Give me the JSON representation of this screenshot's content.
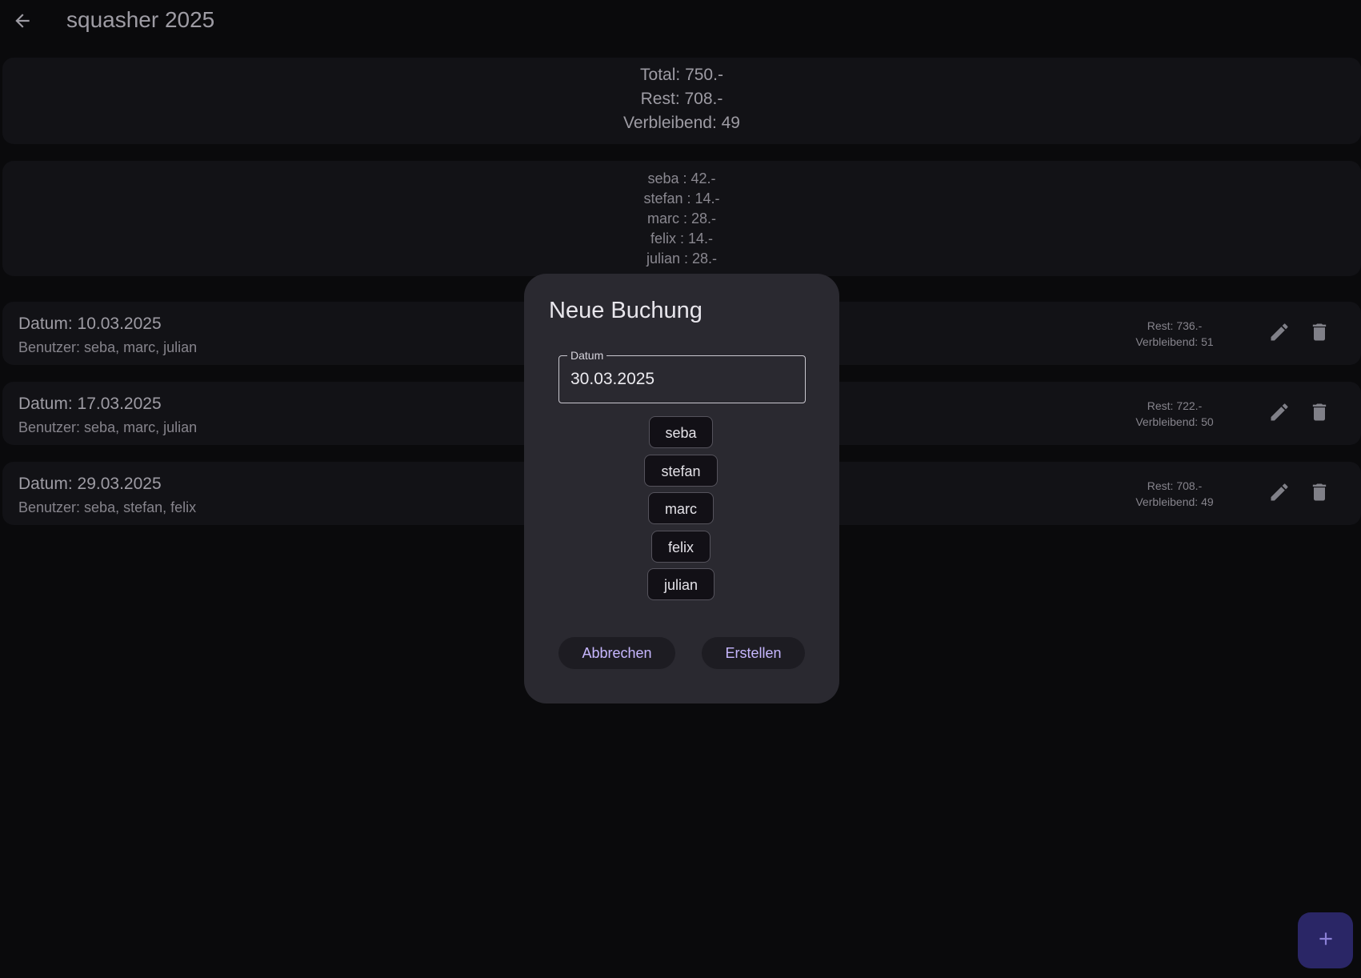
{
  "app_bar": {
    "title": "squasher 2025"
  },
  "summary": {
    "total": "Total: 750.-",
    "rest": "Rest: 708.-",
    "verbleibend": "Verbleibend: 49"
  },
  "user_totals": [
    "seba : 42.-",
    "stefan : 14.-",
    "marc : 28.-",
    "felix : 14.-",
    "julian : 28.-"
  ],
  "bookings": [
    {
      "date": "Datum: 10.03.2025",
      "users": "Benutzer: seba, marc, julian",
      "rest": "Rest: 736.-",
      "verbleibend": "Verbleibend: 51"
    },
    {
      "date": "Datum: 17.03.2025",
      "users": "Benutzer: seba, marc, julian",
      "rest": "Rest: 722.-",
      "verbleibend": "Verbleibend: 50"
    },
    {
      "date": "Datum: 29.03.2025",
      "users": "Benutzer: seba, stefan, felix",
      "rest": "Rest: 708.-",
      "verbleibend": "Verbleibend: 49"
    }
  ],
  "dialog": {
    "title": "Neue Buchung",
    "date_field": {
      "label": "Datum",
      "value": "30.03.2025"
    },
    "chips": [
      "seba",
      "stefan",
      "marc",
      "felix",
      "julian"
    ],
    "cancel_label": "Abbrechen",
    "create_label": "Erstellen"
  },
  "icons": {
    "back": "arrow-back-icon",
    "edit": "pencil-icon",
    "delete": "trash-icon",
    "add": "plus-icon"
  },
  "colors": {
    "background": "#0a0a0c",
    "card": "#121216",
    "dialog": "#2a2930",
    "accent_text": "#c7b7ff",
    "fab": "#2a2666"
  }
}
